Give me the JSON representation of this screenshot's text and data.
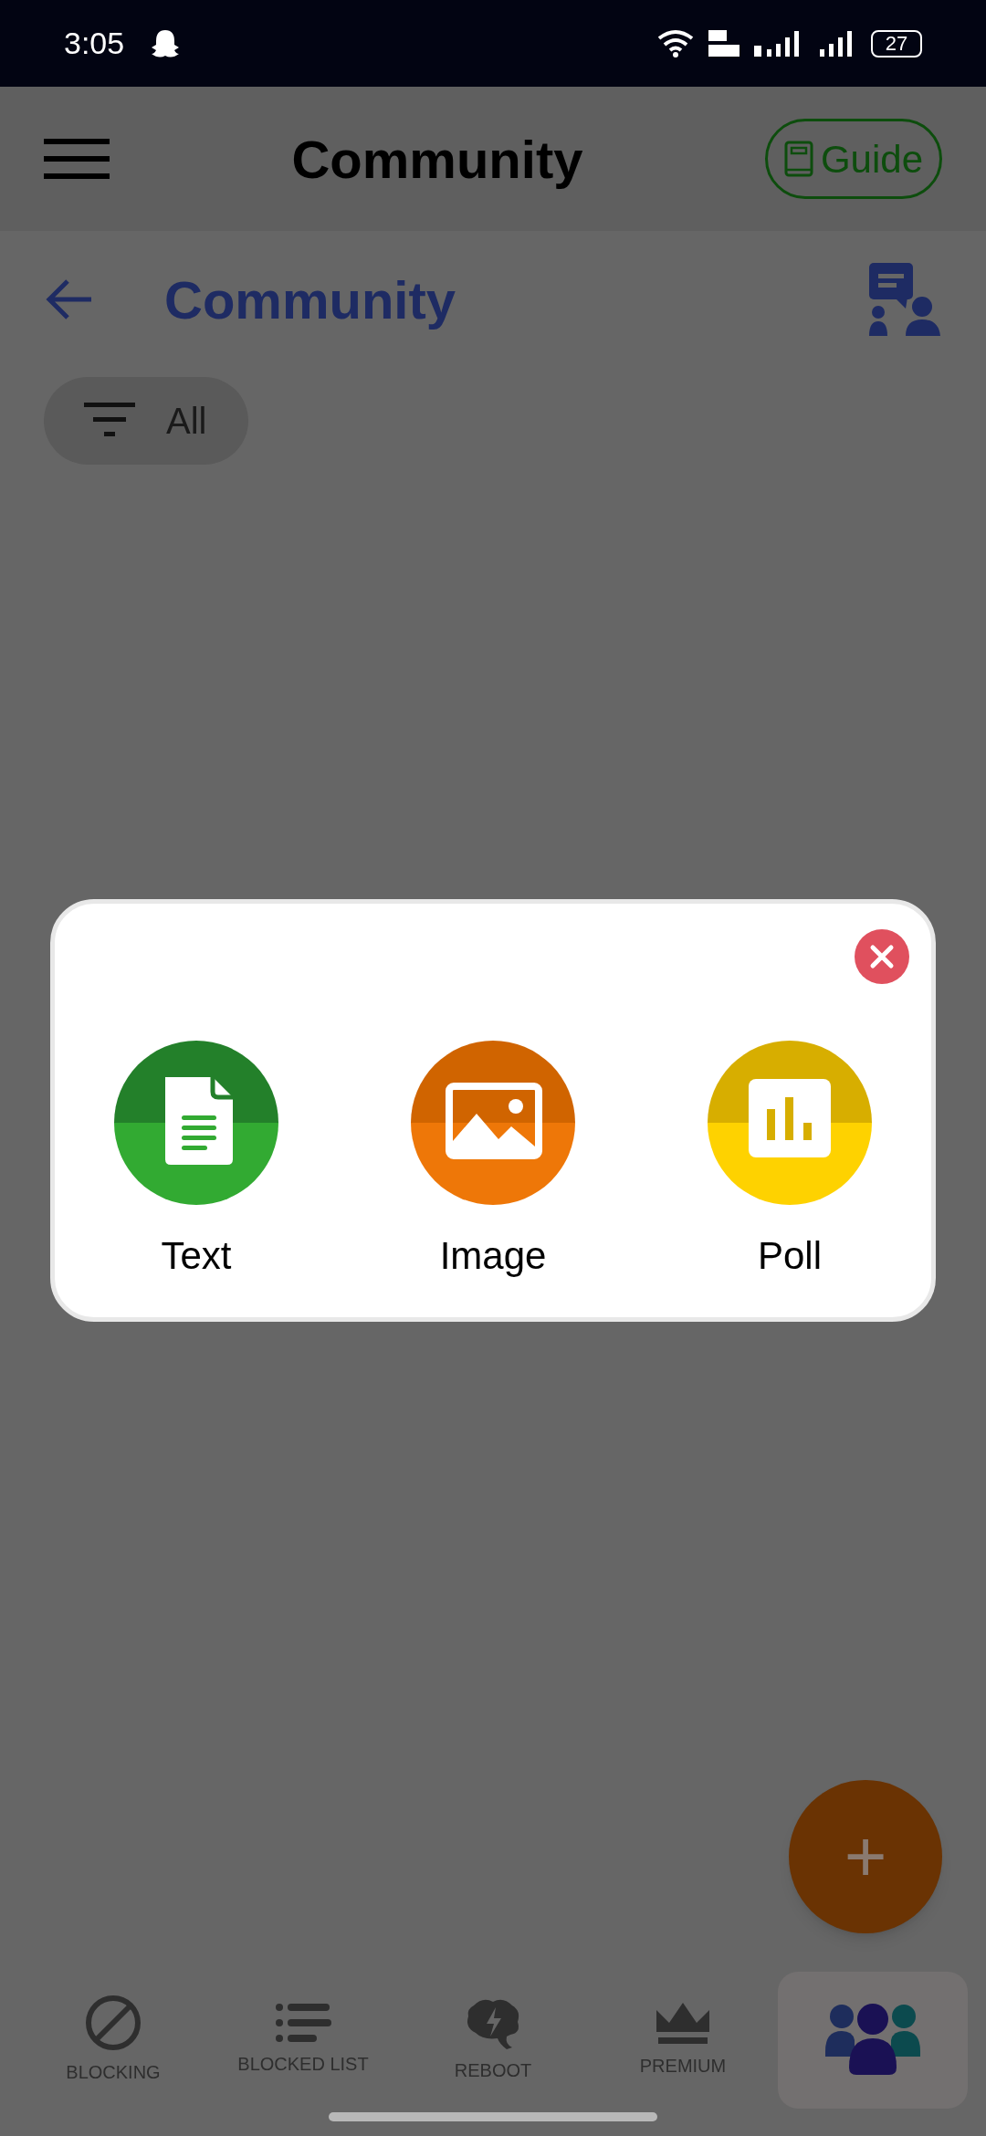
{
  "status_bar": {
    "time": "3:05",
    "battery": "27"
  },
  "app_bar": {
    "title": "Community",
    "guide_button": "Guide"
  },
  "page_header": {
    "title": "Community"
  },
  "filter": {
    "label": "All"
  },
  "dialog": {
    "options": [
      {
        "kind": "text",
        "label": "Text"
      },
      {
        "kind": "image",
        "label": "Image"
      },
      {
        "kind": "poll",
        "label": "Poll"
      }
    ]
  },
  "fab": {
    "label": "+"
  },
  "bottom_nav": [
    {
      "kind": "blocking",
      "label": "BLOCKING",
      "selected": false
    },
    {
      "kind": "list",
      "label": "BLOCKED LIST",
      "selected": false
    },
    {
      "kind": "reboot",
      "label": "REBOOT",
      "selected": false
    },
    {
      "kind": "premium",
      "label": "PREMIUM",
      "selected": false
    },
    {
      "kind": "community",
      "selected": true
    }
  ]
}
